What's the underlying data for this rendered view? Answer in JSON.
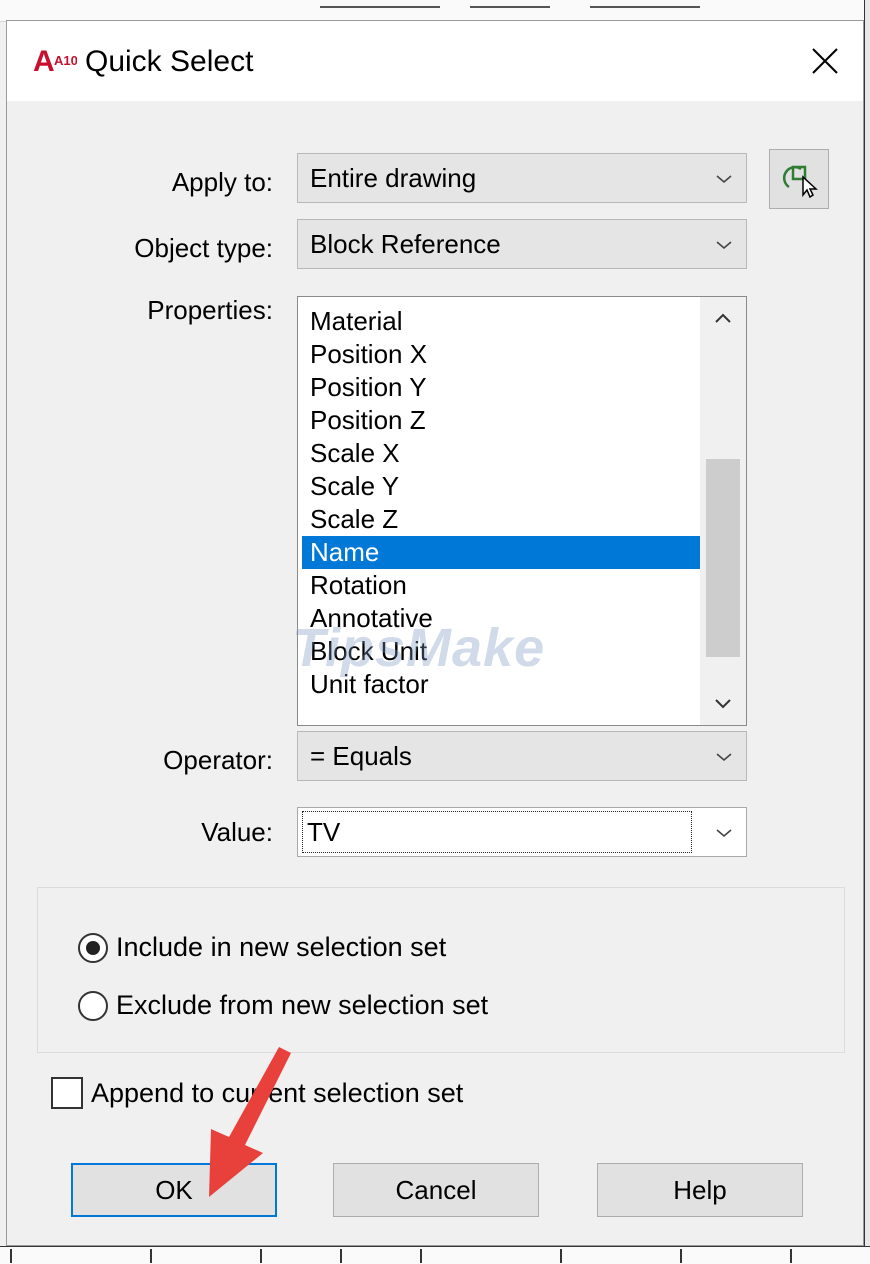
{
  "dialog": {
    "title": "Quick Select",
    "app_icon_text": "A10"
  },
  "apply_to": {
    "label": "Apply to:",
    "value": "Entire drawing"
  },
  "object_type": {
    "label": "Object type:",
    "value": "Block Reference"
  },
  "properties": {
    "label": "Properties:",
    "items": [
      "Material",
      "Position X",
      "Position Y",
      "Position Z",
      "Scale X",
      "Scale Y",
      "Scale Z",
      "Name",
      "Rotation",
      "Annotative",
      "Block Unit",
      "Unit factor"
    ],
    "selected": "Name"
  },
  "watermark": "TipsMake",
  "operator": {
    "label": "Operator:",
    "value": "= Equals"
  },
  "value": {
    "label": "Value:",
    "value": "TV"
  },
  "selection_mode": {
    "include": "Include in new selection set",
    "exclude": "Exclude from new selection set",
    "selected": "include"
  },
  "append": {
    "label": "Append to current selection set",
    "checked": false
  },
  "buttons": {
    "ok": "OK",
    "cancel": "Cancel",
    "help": "Help"
  },
  "colors": {
    "selection": "#0078d7",
    "arrow": "#e8413c"
  }
}
